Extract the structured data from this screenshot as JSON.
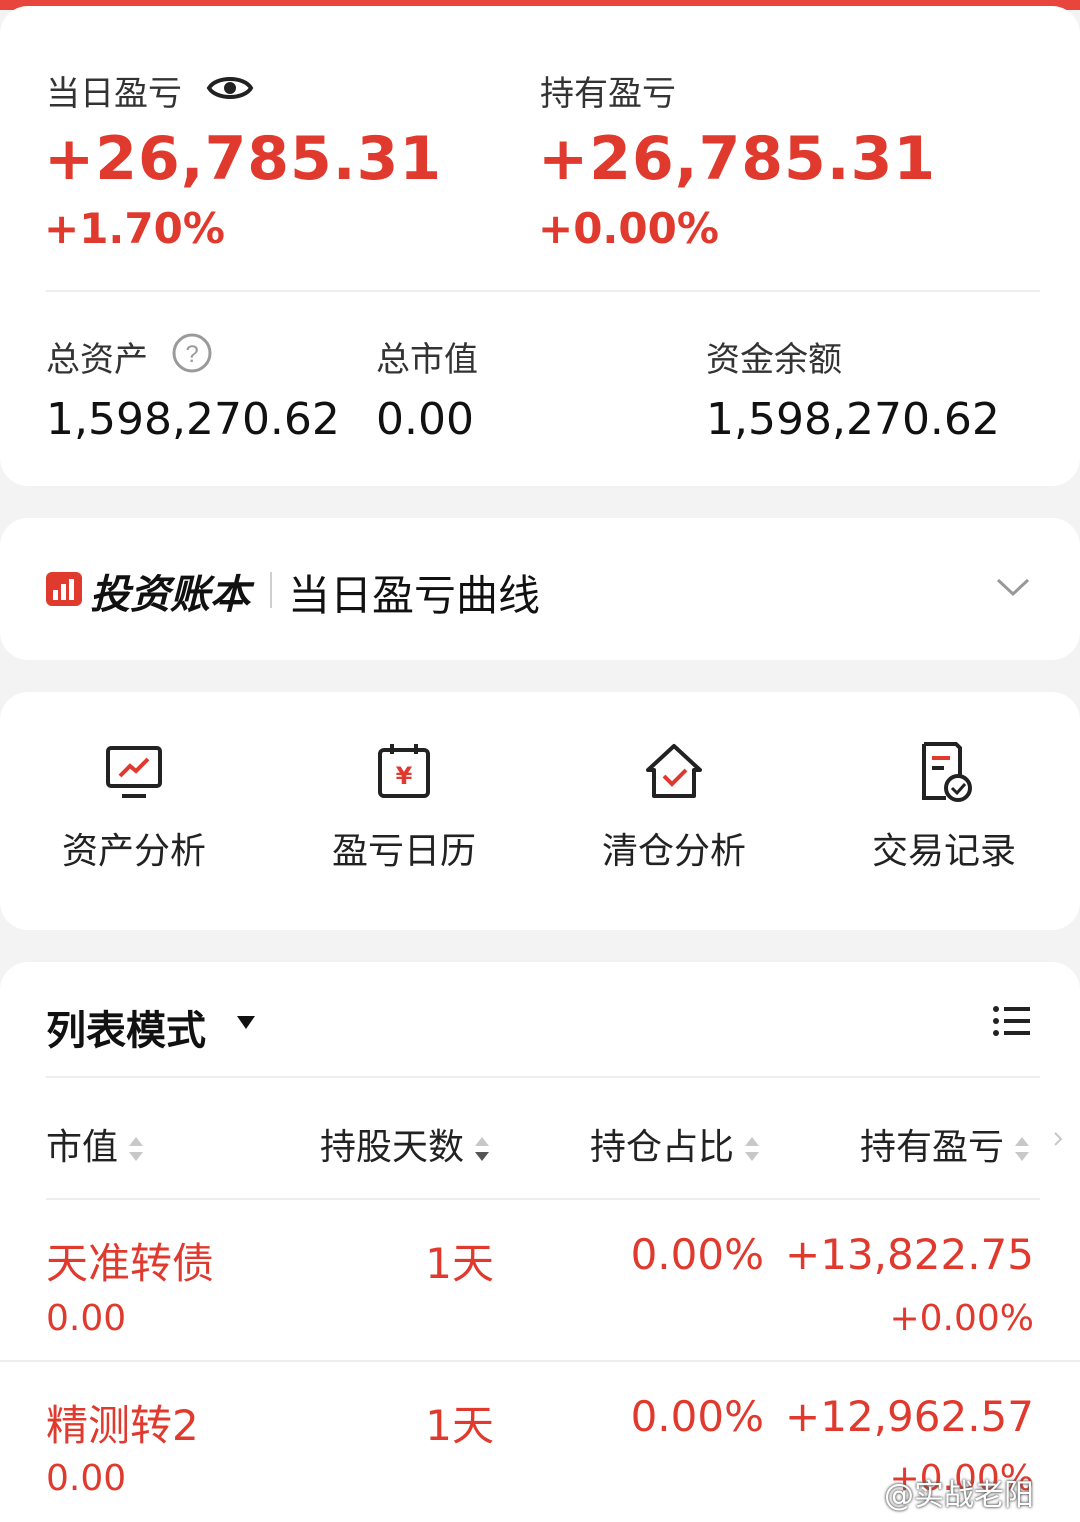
{
  "colors": {
    "accent_red": "#e03a2f",
    "top_bar": "#e8453c"
  },
  "summary": {
    "daily_pl_label": "当日盈亏",
    "daily_pl_value": "+26,785.31",
    "daily_pl_pct": "+1.70%",
    "holding_pl_label": "持有盈亏",
    "holding_pl_value": "+26,785.31",
    "holding_pl_pct": "+0.00%",
    "total_assets_label": "总资产",
    "total_assets_value": "1,598,270.62",
    "market_value_label": "总市值",
    "market_value_value": "0.00",
    "cash_balance_label": "资金余额",
    "cash_balance_value": "1,598,270.62",
    "icons": {
      "visibility": "eye-icon",
      "help": "question-circle-icon"
    }
  },
  "ledger": {
    "brand": "投资账本",
    "title": "当日盈亏曲线",
    "expand_icon": "chevron-down-icon"
  },
  "tools": [
    {
      "label": "资产分析",
      "icon": "monitor-chart-icon"
    },
    {
      "label": "盈亏日历",
      "icon": "yen-calendar-icon"
    },
    {
      "label": "清仓分析",
      "icon": "house-check-icon"
    },
    {
      "label": "交易记录",
      "icon": "document-check-icon"
    }
  ],
  "list": {
    "mode_label": "列表模式",
    "columns": [
      "市值",
      "持股天数",
      "持仓占比",
      "持有盈亏"
    ],
    "rows": [
      {
        "name": "天准转债",
        "market_value": "0.00",
        "days": "1天",
        "ratio": "0.00%",
        "pl": "+13,822.75",
        "pl_pct": "+0.00%"
      },
      {
        "name": "精测转2",
        "market_value": "0.00",
        "days": "1天",
        "ratio": "0.00%",
        "pl": "+12,962.57",
        "pl_pct": "+0.00%"
      }
    ]
  },
  "watermark": "@实战老阳"
}
